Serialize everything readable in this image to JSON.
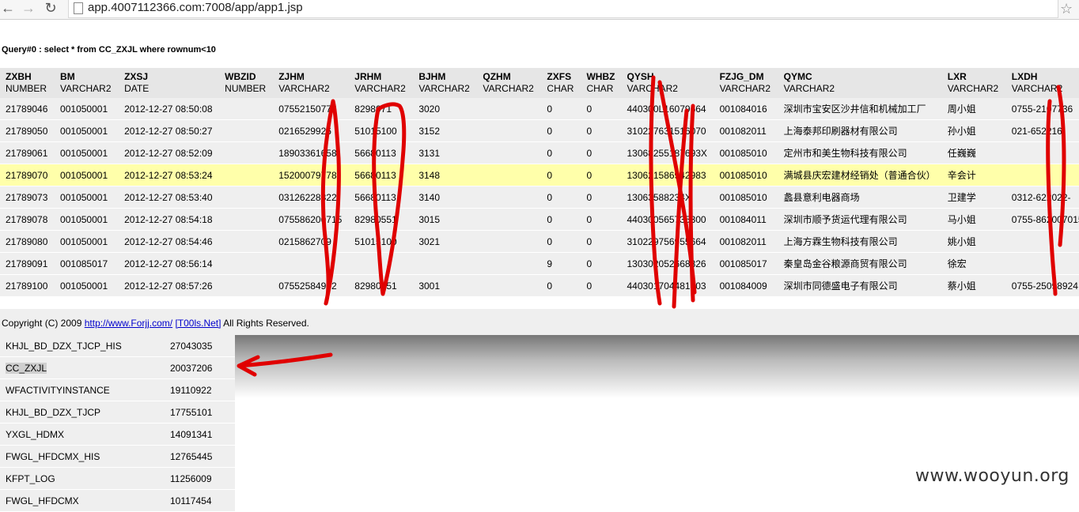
{
  "browser": {
    "url": "app.4007112366.com:7008/app/app1.jsp"
  },
  "query": {
    "text": "Query#0 : select * from CC_ZXJL where rownum<10"
  },
  "table": {
    "columns": [
      {
        "name": "ZXBH",
        "type": "NUMBER"
      },
      {
        "name": "BM",
        "type": "VARCHAR2"
      },
      {
        "name": "ZXSJ",
        "type": "DATE"
      },
      {
        "name": "WBZID",
        "type": "NUMBER"
      },
      {
        "name": "ZJHM",
        "type": "VARCHAR2"
      },
      {
        "name": "JRHM",
        "type": "VARCHAR2"
      },
      {
        "name": "BJHM",
        "type": "VARCHAR2"
      },
      {
        "name": "QZHM",
        "type": "VARCHAR2"
      },
      {
        "name": "ZXFS",
        "type": "CHAR"
      },
      {
        "name": "WHBZ",
        "type": "CHAR"
      },
      {
        "name": "QYSH",
        "type": "VARCHAR2"
      },
      {
        "name": "FZJG_DM",
        "type": "VARCHAR2"
      },
      {
        "name": "QYMC",
        "type": "VARCHAR2"
      },
      {
        "name": "LXR",
        "type": "VARCHAR2"
      },
      {
        "name": "LXDH",
        "type": "VARCHAR2"
      }
    ],
    "rows": [
      [
        "21789046",
        "001050001",
        "2012-12-27 08:50:08",
        "",
        "07552150776",
        "8298071",
        "3020",
        "",
        "0",
        "0",
        "440300L16079664",
        "001084016",
        "深圳市宝安区沙井信和机械加工厂",
        "周小姐",
        "0755-2107736"
      ],
      [
        "21789050",
        "001050001",
        "2012-12-27 08:50:27",
        "",
        "0216529926",
        "51015100",
        "3152",
        "",
        "0",
        "0",
        "310227631516070",
        "001082011",
        "上海泰邦印刷器材有限公司",
        "孙小姐",
        "021-652216-"
      ],
      [
        "21789061",
        "001050001",
        "2012-12-27 08:52:09",
        "",
        "18903361658",
        "56680113",
        "3131",
        "",
        "0",
        "0",
        "13068255187693X",
        "001085010",
        "定州市和美生物科技有限公司",
        "任巍巍",
        ""
      ],
      [
        "21789070",
        "001050001",
        "2012-12-27 08:53:24",
        "",
        "15200079778",
        "56680113",
        "3148",
        "",
        "0",
        "0",
        "130621586942983",
        "001085010",
        "满城县庆宏建材经销处（普通合伙）",
        "辛会计",
        ""
      ],
      [
        "21789073",
        "001050001",
        "2012-12-27 08:53:40",
        "",
        "03126228322",
        "56680113",
        "3140",
        "",
        "0",
        "0",
        "13063588234X",
        "001085010",
        "蠡县意利电器商场",
        "卫建学",
        "0312-622022-"
      ],
      [
        "21789078",
        "001050001",
        "2012-12-27 08:54:18",
        "",
        "075586200715",
        "82980551",
        "3015",
        "",
        "0",
        "0",
        "440300565735300",
        "001084011",
        "深圳市顺予货运代理有限公司",
        "马小姐",
        "0755-862007015-"
      ],
      [
        "21789080",
        "001050001",
        "2012-12-27 08:54:46",
        "",
        "0215862709",
        "51015100",
        "3021",
        "",
        "0",
        "0",
        "310229756955664",
        "001082011",
        "上海方霖生物科技有限公司",
        "姚小姐",
        ""
      ],
      [
        "21789091",
        "001085017",
        "2012-12-27 08:56:14",
        "",
        "",
        "",
        "",
        "",
        "9",
        "0",
        "130302052668826",
        "001085017",
        "秦皇岛金谷粮源商贸有限公司",
        "徐宏",
        ""
      ],
      [
        "21789100",
        "001050001",
        "2012-12-27 08:57:26",
        "",
        "07552584992",
        "82980551",
        "3001",
        "",
        "0",
        "0",
        "440301704481903",
        "001084009",
        "深圳市同德盛电子有限公司",
        "蔡小姐",
        "0755-25098924"
      ]
    ]
  },
  "footer": {
    "copyright": "Copyright (C) 2009",
    "link1": "http://www.Forjj.com/",
    "link2": "[T00ls.Net]",
    "rights": "All Rights Reserved."
  },
  "stats": [
    {
      "name": "KHJL_BD_DZX_TJCP_HIS",
      "count": "27043035"
    },
    {
      "name": "CC_ZXJL",
      "count": "20037206"
    },
    {
      "name": "WFACTIVITYINSTANCE",
      "count": "19110922"
    },
    {
      "name": "KHJL_BD_DZX_TJCP",
      "count": "17755101"
    },
    {
      "name": "YXGL_HDMX",
      "count": "14091341"
    },
    {
      "name": "FWGL_HFDCMX_HIS",
      "count": "12765445"
    },
    {
      "name": "KFPT_LOG",
      "count": "11256009"
    },
    {
      "name": "FWGL_HFDCMX",
      "count": "10117454"
    }
  ],
  "watermark": "www.wooyun.org",
  "colors": {
    "highlight_row": "#ffffaa",
    "annotation": "#e00000",
    "link": "#0000cc"
  },
  "icons": {
    "back": "back-arrow-icon",
    "forward": "forward-arrow-icon",
    "reload": "reload-icon",
    "bookmark": "star-icon"
  }
}
